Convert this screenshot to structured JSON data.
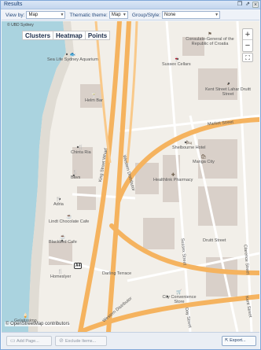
{
  "window": {
    "title": "Results"
  },
  "toolbar": {
    "view_by_label": "View by:",
    "view_by_value": "Map",
    "thematic_label": "Thematic theme:",
    "thematic_value": "Map",
    "group_by_label": "Group/Style:",
    "group_by_value": "None"
  },
  "map": {
    "attribution_top": "© UBD Sydney",
    "modes": [
      "Clusters",
      "Heatmap",
      "Points"
    ],
    "zoom_in": "+",
    "zoom_out": "−",
    "extent": "⛶",
    "pois": [
      "Consulate-General of the Republic of Croatia",
      "Sussex Cellars",
      "Sea Life Sydney Aquarium",
      "Kent Street Lahar Druitt Street",
      "Helm Bar",
      "Shelbourne Hotel",
      "Chinta Ria",
      "Manga City",
      "Bavs",
      "Healthlink Pharmacy",
      "Adria",
      "Lindt Chocolate Cafe",
      "Blackbird Cafe",
      "Homeslyer",
      "City Convenience Store",
      "Gelatissimo"
    ],
    "streets": [
      "Market Street",
      "King Street Wharf",
      "Western Distributor",
      "Sussex Street",
      "Druitt Street",
      "Day Street",
      "Darling Terrace",
      "Western Distributor",
      "Clarence Street",
      "Kent Street"
    ],
    "shield": "A4",
    "attribution_bottom": "© OpenStreetMap contributors"
  },
  "bottom": {
    "add_button": "Add Page...",
    "exclude_button": "Exclude Items...",
    "export_button": "Export..."
  }
}
